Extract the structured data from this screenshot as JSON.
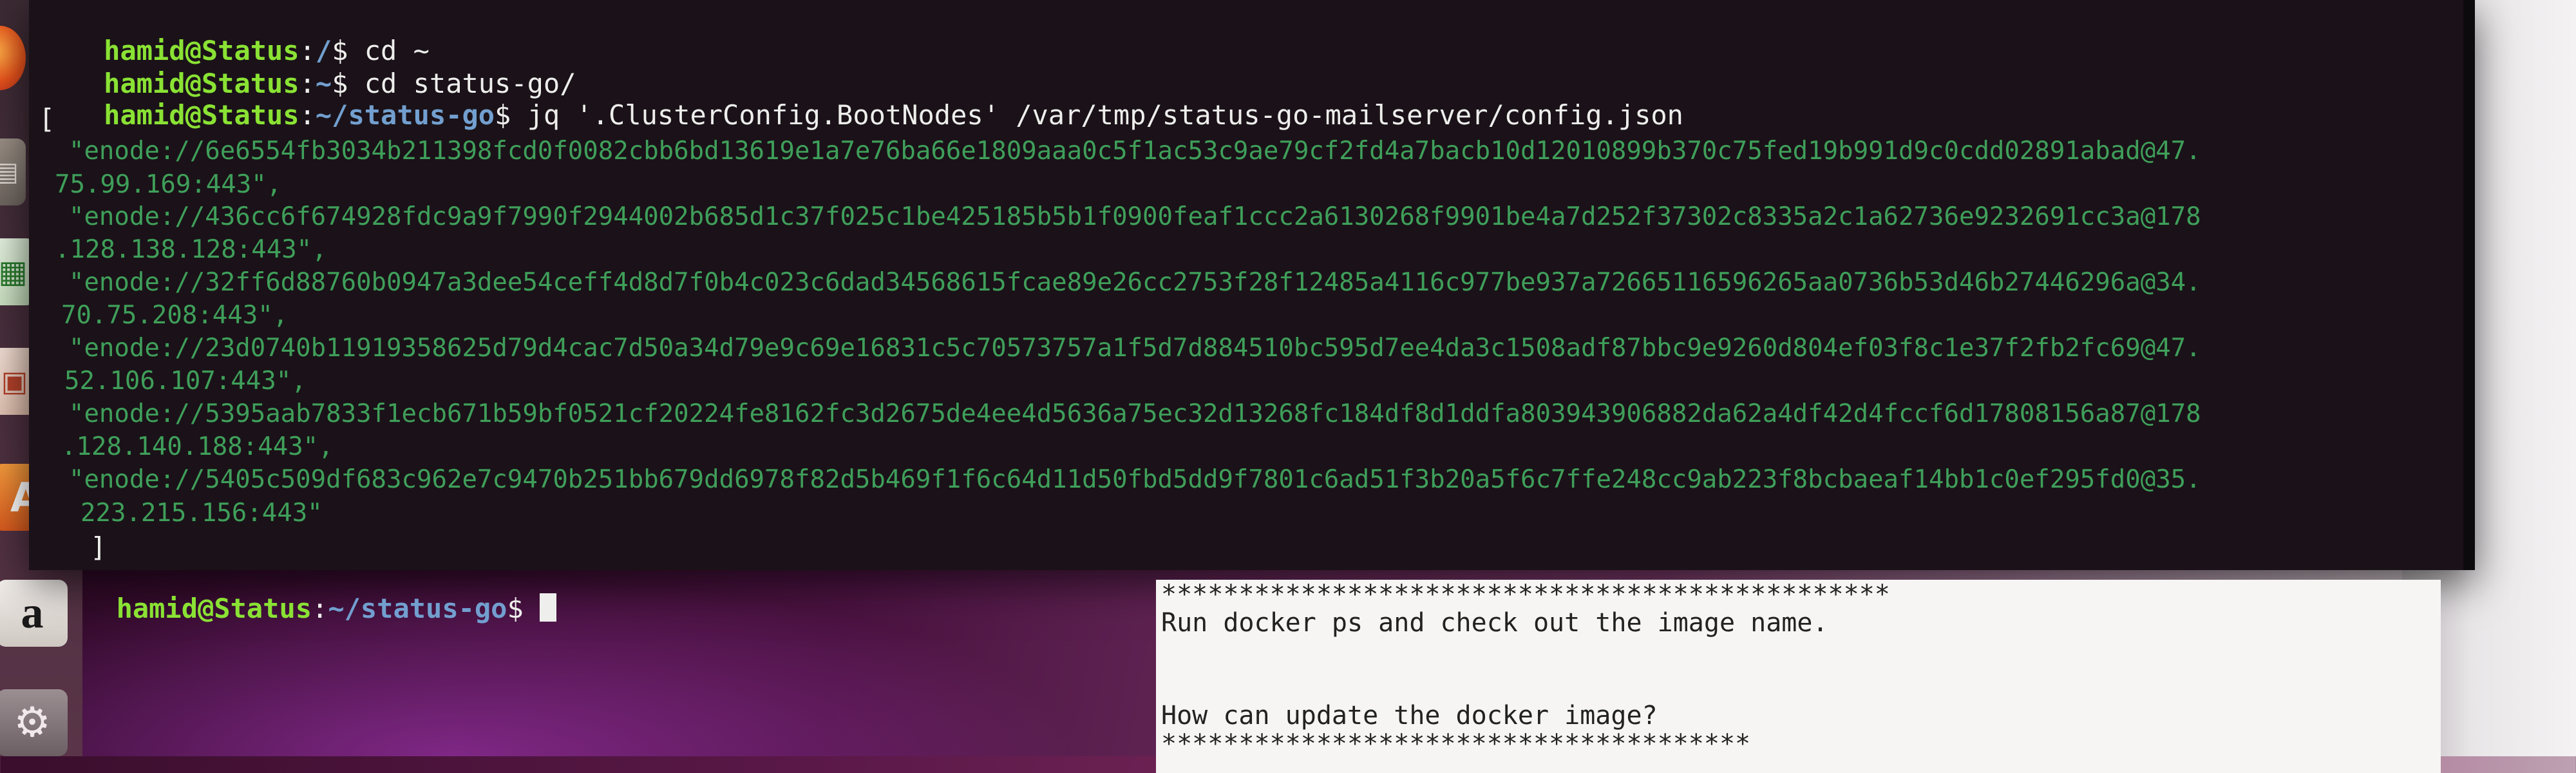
{
  "launcher": {
    "icons": [
      "firefox-icon",
      "files-icon",
      "libreoffice-calc-icon",
      "libreoffice-impress-icon",
      "software-center-icon",
      "amazon-icon",
      "system-settings-icon"
    ],
    "amazon_glyph": "a",
    "software_glyph": "A"
  },
  "terminal": {
    "lines": [
      {
        "user": "hamid@Status",
        "sep": ":",
        "path": "/",
        "symbol": "$ ",
        "command": "cd ~"
      },
      {
        "user": "hamid@Status",
        "sep": ":",
        "path": "~",
        "symbol": "$ ",
        "command": "cd status-go/"
      },
      {
        "user": "hamid@Status",
        "sep": ":",
        "path": "~/status-go",
        "symbol": "$ ",
        "command": "jq '.ClusterConfig.BootNodes' /var/tmp/status-go-mailserver/config.json"
      }
    ],
    "open_bracket": "[",
    "nodes": [
      {
        "line1": "  \"enode://6e6554fb3034b211398fcd0f0082cbb6bd13619e1a7e76ba66e1809aaa0c5f1ac53c9ae79cf2fd4a7bacb10d12010899b370c75fed19b991d9c0cdd02891abad@47.",
        "line2": "75.99.169:443\","
      },
      {
        "line1": "  \"enode://436cc6f674928fdc9a9f7990f2944002b685d1c37f025c1be425185b5b1f0900feaf1ccc2a6130268f9901be4a7d252f37302c8335a2c1a62736e9232691cc3a@178",
        "line2": ".128.138.128:443\","
      },
      {
        "line1": "  \"enode://32ff6d88760b0947a3dee54ceff4d8d7f0b4c023c6dad34568615fcae89e26cc2753f28f12485a4116c977be937a72665116596265aa0736b53d46b27446296a@34.",
        "line2": "70.75.208:443\","
      },
      {
        "line1": "  \"enode://23d0740b11919358625d79d4cac7d50a34d79e9c69e16831c5c70573757a1f5d7d884510bc595d7ee4da3c1508adf87bbc9e9260d804ef03f8c1e37f2fb2fc69@47.",
        "line2": "52.106.107:443\","
      },
      {
        "line1": "  \"enode://5395aab7833f1ecb671b59bf0521cf20224fe8162fc3d2675de4ee4d5636a75ec32d13268fc184df8d1ddfa803943906882da62a4df42d4fccf6d17808156a87@178",
        "line2": ".128.140.188:443\","
      },
      {
        "line1": "  \"enode://5405c509df683c962e7c9470b251bb679dd6978f82d5b469f1f6c64d11d50fbd5dd9f7801c6ad51f3b20a5f6c7ffe248cc9ab223f8bcbaeaf14bb1c0ef295fd0@35.",
        "line2": "223.215.156:443\""
      }
    ],
    "close_bracket": "]",
    "final_prompt": {
      "user": "hamid@Status",
      "sep": ":",
      "path": "~/status-go",
      "symbol": "$ "
    }
  },
  "note": {
    "stars_top": "***********************************************",
    "line1": "Run docker ps and check out the image name.",
    "line2": "",
    "line3": "How can update the docker image?",
    "stars_bottom": "**************************************"
  }
}
